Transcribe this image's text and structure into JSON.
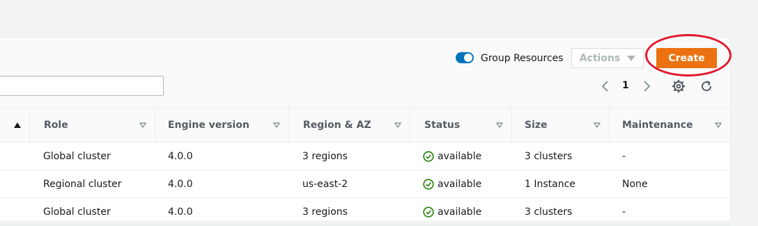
{
  "toolbar": {
    "group_toggle_label": "Group Resources",
    "group_toggle_on": true,
    "actions_label": "Actions",
    "create_label": "Create",
    "search_value": "",
    "page_number": "1"
  },
  "colors": {
    "accent_blue": "#0073bb",
    "primary_orange": "#ec7211",
    "annotation_red": "#e3172d",
    "status_green": "#1d8102"
  },
  "table": {
    "columns": [
      {
        "label": "",
        "sort": "asc"
      },
      {
        "label": "Role"
      },
      {
        "label": "Engine version"
      },
      {
        "label": "Region & AZ"
      },
      {
        "label": "Status"
      },
      {
        "label": "Size"
      },
      {
        "label": "Maintenance"
      }
    ],
    "rows": [
      {
        "role": "Global cluster",
        "engine": "4.0.0",
        "region": "3 regions",
        "status": "available",
        "size": "3 clusters",
        "maintenance": "-"
      },
      {
        "role": "Regional cluster",
        "engine": "4.0.0",
        "region": "us-east-2",
        "status": "available",
        "size": "1 Instance",
        "maintenance": "None"
      },
      {
        "role": "Global cluster",
        "engine": "4.0.0",
        "region": "3 regions",
        "status": "available",
        "size": "3 clusters",
        "maintenance": "-"
      }
    ]
  }
}
